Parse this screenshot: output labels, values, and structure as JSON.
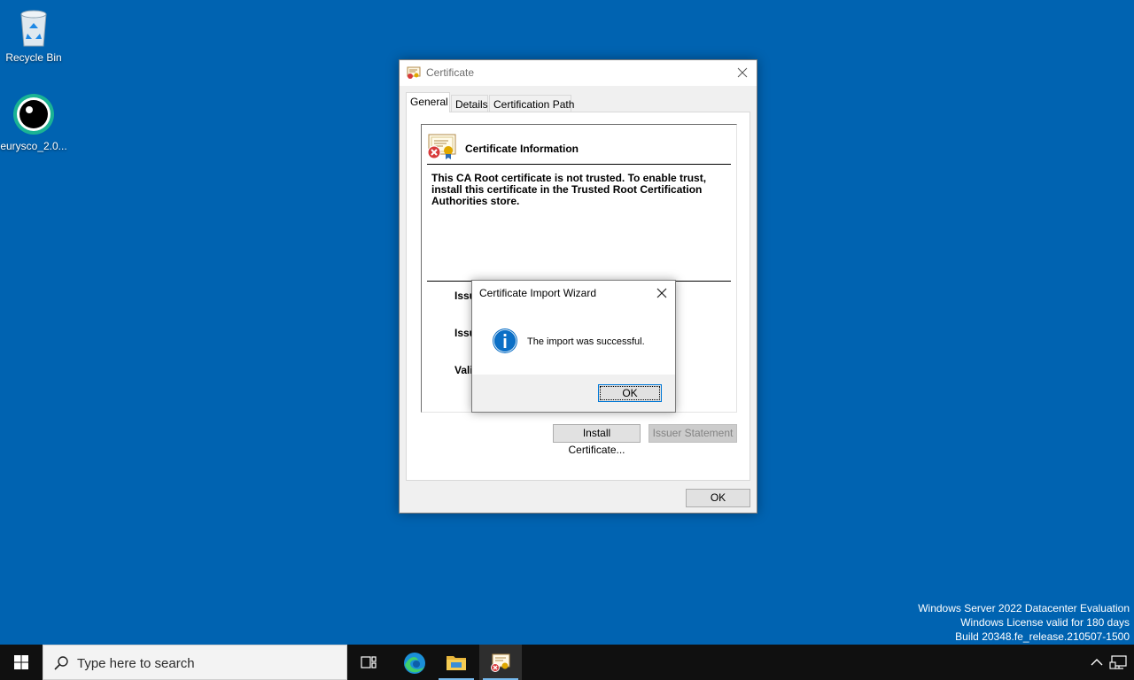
{
  "desktop": {
    "icons": [
      {
        "label": "Recycle Bin",
        "icon": "recycle-bin-icon"
      },
      {
        "label": "eurysco_2.0...",
        "icon": "eurysco-eye-icon"
      }
    ]
  },
  "certificate_window": {
    "title": "Certificate",
    "tabs": [
      {
        "label": "General",
        "active": true
      },
      {
        "label": "Details",
        "active": false
      },
      {
        "label": "Certification Path",
        "active": false
      }
    ],
    "info_heading": "Certificate Information",
    "warning": "This CA Root certificate is not trusted. To enable trust, install this certificate in the Trusted Root Certification Authorities store.",
    "fields": {
      "issued_to": "Issu",
      "issued_by": "Issu",
      "valid": "Vali"
    },
    "buttons": {
      "install": "Install Certificate...",
      "issuer_statement": "Issuer Statement",
      "ok": "OK"
    }
  },
  "import_wizard": {
    "title": "Certificate Import Wizard",
    "message": "The import was successful.",
    "ok": "OK"
  },
  "watermark": {
    "line1": "Windows Server 2022 Datacenter Evaluation",
    "line2": "Windows License valid for 180 days",
    "line3": "Build 20348.fe_release.210507-1500"
  },
  "taskbar": {
    "search_placeholder": "Type here to search",
    "items": [
      "task-view-icon",
      "edge-icon",
      "file-explorer-icon",
      "certificate-manager-icon"
    ],
    "accent": "#0063b1"
  }
}
